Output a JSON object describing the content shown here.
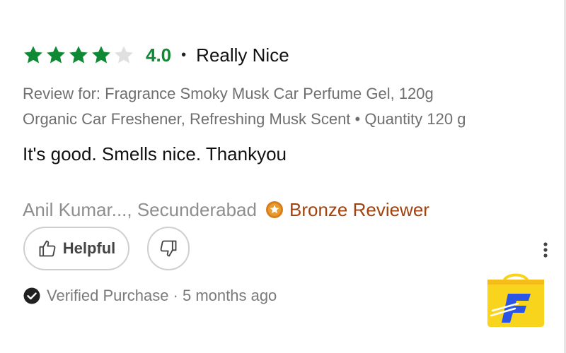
{
  "review": {
    "rating": {
      "stars_filled": 4,
      "stars_total": 5,
      "value": "4.0",
      "separator": "•",
      "title": "Really Nice"
    },
    "review_for_line1": "Review for: Fragrance Smoky Musk Car Perfume Gel, 120g",
    "review_for_line2": "Organic Car Freshener, Refreshing Musk Scent • Quantity 120 g",
    "body": "It's good. Smells nice. Thankyou",
    "author": "Anil Kumar..., Secunderabad",
    "badge": "Bronze Reviewer",
    "helpful_label": "Helpful",
    "verified": "Verified Purchase · 5 months ago"
  },
  "icons": {
    "star": "star-icon",
    "badge": "star-badge-icon",
    "thumbs_up": "thumbs-up-icon",
    "thumbs_down": "thumbs-down-icon",
    "more": "more-vertical-icon",
    "verified": "check-circle-icon",
    "logo": "shopping-bag-logo"
  },
  "colors": {
    "star_filled": "#108934",
    "star_empty": "#e0e0e0",
    "rating_value": "#108934",
    "badge": "#a2430f",
    "logo_bag": "#f9d41c",
    "logo_mark": "#2a55e5"
  }
}
